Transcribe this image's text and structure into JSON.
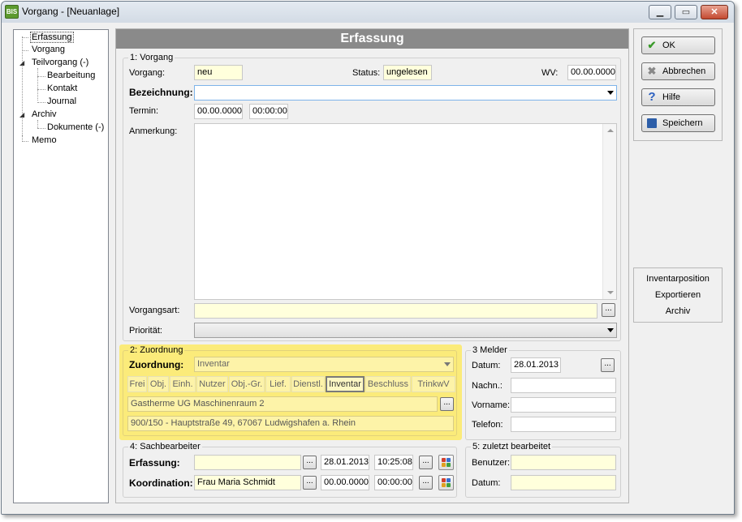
{
  "window": {
    "title": "Vorgang - [Neuanlage]",
    "icon_text": "BIS"
  },
  "tree": {
    "items": [
      {
        "label": "Erfassung"
      },
      {
        "label": "Vorgang"
      },
      {
        "label": "Teilvorgang (-)"
      },
      {
        "label": "Bearbeitung"
      },
      {
        "label": "Kontakt"
      },
      {
        "label": "Journal"
      },
      {
        "label": "Archiv"
      },
      {
        "label": "Dokumente (-)"
      },
      {
        "label": "Memo"
      }
    ]
  },
  "header": {
    "title": "Erfassung"
  },
  "vorgang_group": {
    "legend": "1: Vorgang",
    "vorgang_label": "Vorgang:",
    "vorgang_value": "neu",
    "status_label": "Status:",
    "status_value": "ungelesen",
    "wv_label": "WV:",
    "wv_value": "00.00.0000",
    "bezeichnung_label": "Bezeichnung:",
    "bezeichnung_value": "",
    "termin_label": "Termin:",
    "termin_date": "00.00.0000",
    "termin_time": "00:00:00",
    "anmerkung_label": "Anmerkung:",
    "vorgangsart_label": "Vorgangsart:",
    "vorgangsart_value": "",
    "prioritaet_label": "Priorität:",
    "prioritaet_value": ""
  },
  "zuordnung_group": {
    "legend": "2: Zuordnung",
    "zuordnung_label": "Zuordnung:",
    "zuordnung_value": "Inventar",
    "tabs": [
      "Frei",
      "Obj.",
      "Einh.",
      "Nutzer",
      "Obj.-Gr.",
      "Lief.",
      "Dienstl.",
      "Inventar",
      "Beschluss",
      "TrinkwV"
    ],
    "active_tab": "Inventar",
    "line1": "Gastherme UG Maschinenraum 2",
    "line2": "900/150 - Hauptstraße 49, 67067 Ludwigshafen a. Rhein"
  },
  "melder_group": {
    "legend": "3 Melder",
    "datum_label": "Datum:",
    "datum_value": "28.01.2013",
    "nachn_label": "Nachn.:",
    "vorname_label": "Vorname:",
    "telefon_label": "Telefon:"
  },
  "sachbearbeiter_group": {
    "legend": "4: Sachbearbeiter",
    "erfassung_label": "Erfassung:",
    "erfassung_name": "",
    "erfassung_date": "28.01.2013",
    "erfassung_time": "10:25:08",
    "koordination_label": "Koordination:",
    "koordination_name": "Frau Maria Schmidt",
    "koordination_date": "00.00.0000",
    "koordination_time": "00:00:00"
  },
  "zuletzt_group": {
    "legend": "5: zuletzt bearbeitet",
    "benutzer_label": "Benutzer:",
    "datum_label": "Datum:"
  },
  "actions": {
    "ok": "OK",
    "abbrechen": "Abbrechen",
    "hilfe": "Hilfe",
    "speichern": "Speichern"
  },
  "links": {
    "inventarposition": "Inventarposition",
    "exportieren": "Exportieren",
    "archiv": "Archiv"
  },
  "dots_label": "...",
  "colors": {
    "highlight": "#fbeb7a",
    "yellow_field": "#ffffdc",
    "banner": "#8a8a8a"
  }
}
